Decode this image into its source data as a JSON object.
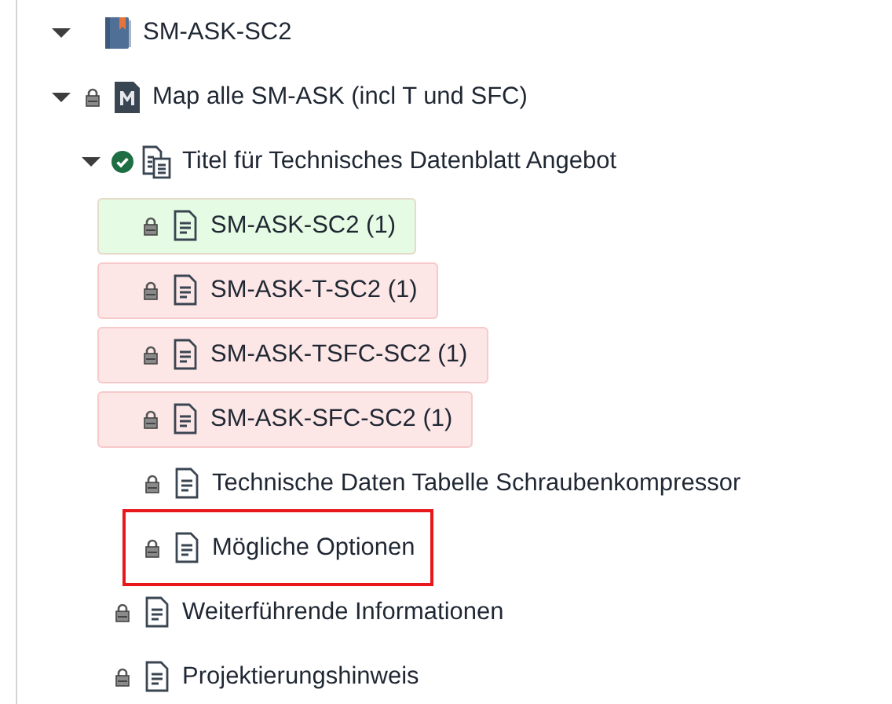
{
  "tree": [
    {
      "label": "SM-ASK-SC2",
      "kind": "book",
      "locked": false,
      "expanded": true,
      "children": [
        {
          "label": "Map alle SM-ASK (incl T und SFC)",
          "kind": "map",
          "locked": true,
          "expanded": true,
          "children": [
            {
              "label": "Titel für Technisches Datenblatt Angebot",
              "kind": "title",
              "locked": false,
              "approved": true,
              "expanded": true,
              "children": [
                {
                  "label": "SM-ASK-SC2 (1)",
                  "kind": "topic",
                  "locked": true,
                  "color": "#e6fbe4"
                },
                {
                  "label": "SM-ASK-T-SC2 (1)",
                  "kind": "topic",
                  "locked": true,
                  "color": "#fde6e6"
                },
                {
                  "label": "SM-ASK-TSFC-SC2 (1)",
                  "kind": "topic",
                  "locked": true,
                  "color": "#fde6e6"
                },
                {
                  "label": "SM-ASK-SFC-SC2 (1)",
                  "kind": "topic",
                  "locked": true,
                  "color": "#fde6e6"
                },
                {
                  "label": "Technische Daten Tabelle Schraubenkompressor",
                  "kind": "topic",
                  "locked": true
                },
                {
                  "label": "Mögliche Optionen",
                  "kind": "topic",
                  "locked": true,
                  "selected": true
                }
              ]
            },
            {
              "label": "Weiterführende Informationen",
              "kind": "topic",
              "locked": true
            },
            {
              "label": "Projektierungshinweis",
              "kind": "topic",
              "locked": true
            }
          ]
        }
      ]
    }
  ]
}
